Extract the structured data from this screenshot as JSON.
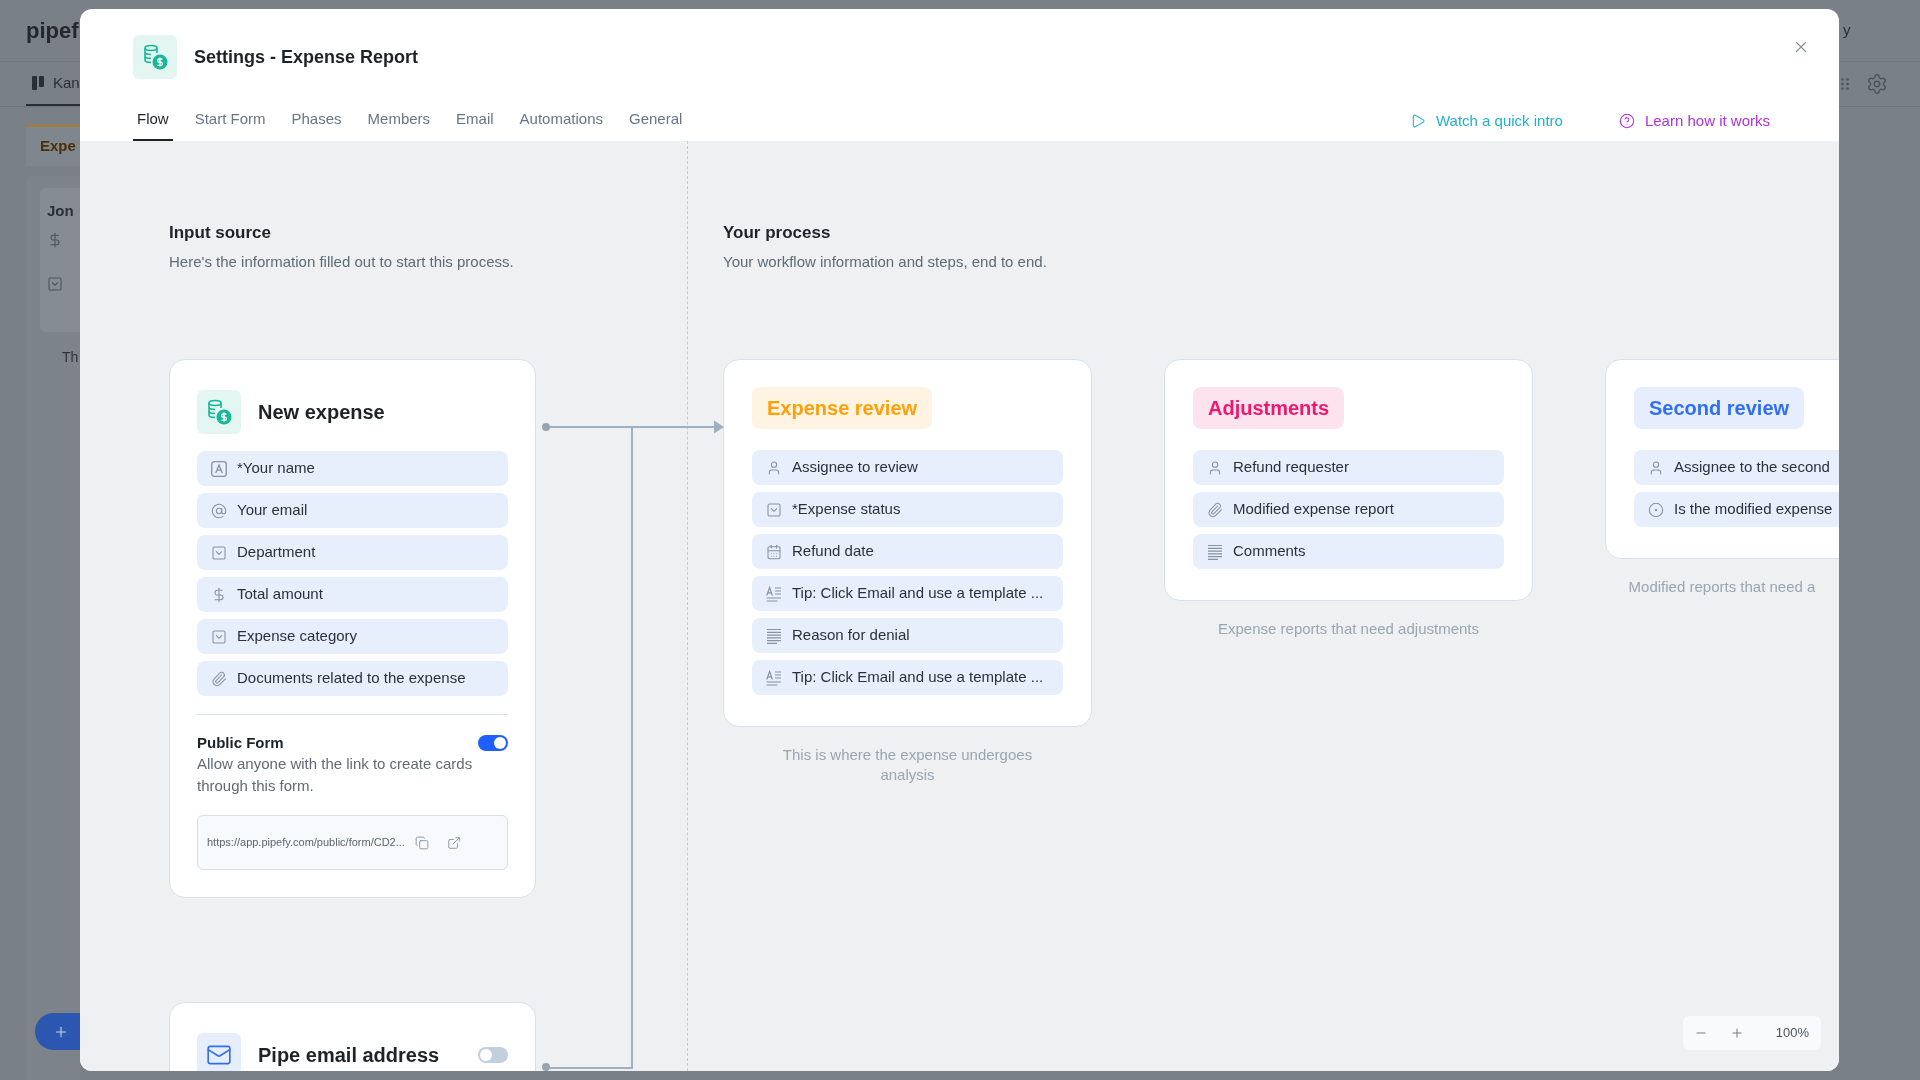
{
  "background": {
    "logo": "pipef",
    "header_text": "y",
    "view_tab": {
      "label": "Kan",
      "selected": true
    },
    "phase": {
      "name": "Expe",
      "card": {
        "title": "Jon"
      }
    },
    "note": "Th"
  },
  "modal": {
    "title": "Settings - Expense Report",
    "tabs": [
      {
        "label": "Flow",
        "selected": true
      },
      {
        "label": "Start Form",
        "selected": false
      },
      {
        "label": "Phases",
        "selected": false
      },
      {
        "label": "Members",
        "selected": false
      },
      {
        "label": "Email",
        "selected": false
      },
      {
        "label": "Automations",
        "selected": false
      },
      {
        "label": "General",
        "selected": false
      }
    ],
    "links": [
      {
        "kind": "video",
        "label": "Watch a quick intro"
      },
      {
        "kind": "help",
        "label": "Learn how it works"
      }
    ],
    "input_source": {
      "title": "Input source",
      "subtitle": "Here's the information filled out to start this process.",
      "sources": [
        {
          "kind": "form",
          "title": "New expense",
          "fields": [
            {
              "kind": "short_text",
              "label": "*Your name"
            },
            {
              "kind": "email",
              "label": "Your email"
            },
            {
              "kind": "select",
              "label": "Department"
            },
            {
              "kind": "currency",
              "label": "Total amount"
            },
            {
              "kind": "select",
              "label": "Expense category"
            },
            {
              "kind": "attachment",
              "label": "Documents related to the expense"
            }
          ],
          "public_form": {
            "title": "Public Form",
            "on": true,
            "description": "Allow anyone with the link to create cards through this form.",
            "url": "https://app.pipefy.com/public/form/CD2..."
          }
        },
        {
          "kind": "email",
          "title": "Pipe email address",
          "on": false
        }
      ]
    },
    "process": {
      "title": "Your process",
      "subtitle": "Your workflow information and steps, end to end.",
      "phases": [
        {
          "name": "Expense review",
          "color": "#ffa00a",
          "fields": [
            {
              "kind": "assignee",
              "label": "Assignee to review"
            },
            {
              "kind": "select",
              "label": "*Expense status"
            },
            {
              "kind": "date",
              "label": "Refund date"
            },
            {
              "kind": "statement",
              "label": "Tip: Click Email and use a template ..."
            },
            {
              "kind": "long_text",
              "label": "Reason for denial"
            },
            {
              "kind": "statement",
              "label": "Tip: Click Email and use a template ..."
            }
          ],
          "description": "This is where the expense undergoes analysis"
        },
        {
          "name": "Adjustments",
          "color": "#f0186e",
          "fields": [
            {
              "kind": "assignee",
              "label": "Refund requester"
            },
            {
              "kind": "attachment",
              "label": "Modified expense report"
            },
            {
              "kind": "long_text",
              "label": "Comments"
            }
          ],
          "description": "Expense reports that need adjustments"
        },
        {
          "name": "Second review",
          "color": "#2f6ff0",
          "fields": [
            {
              "kind": "assignee",
              "label": "Assignee to the second"
            },
            {
              "kind": "radio",
              "label": "Is the modified expense"
            }
          ],
          "description": "Modified reports that need a"
        }
      ]
    },
    "zoom": {
      "label": "100%"
    }
  }
}
